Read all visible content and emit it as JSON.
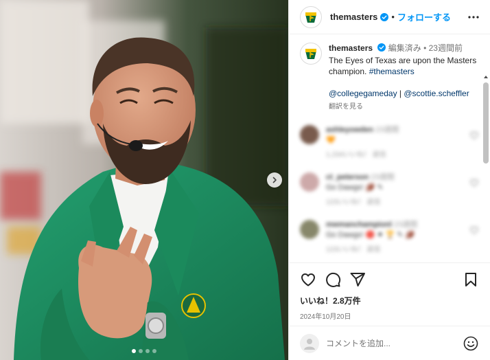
{
  "post": {
    "username": "themasters",
    "follow_label": "フォローする",
    "separator": "•",
    "media": {
      "dot_count": 4,
      "active_dot": 0
    },
    "caption": {
      "username": "themasters",
      "edited": "編集済み",
      "dot": "•",
      "time": "23週間前",
      "text": "The Eyes of Texas are upon the Masters champion. ",
      "hashtag": "#themasters",
      "mention_1": "@collegegameday",
      "mention_sep": " | ",
      "mention_2": "@scottie.scheffler",
      "translate": "翻訳を見る"
    },
    "comments": [
      {
        "user": "ashleyowden",
        "time": "23週間",
        "body": "🧡",
        "meta": "1,234いいね！ 返信",
        "avatar_color": "#6b4a3a"
      },
      {
        "user": "ct_peterson",
        "time": "23週間",
        "body": "Go Dawgs! 🏈 ✎",
        "meta": "123いいね！ 返信",
        "avatar_color": "#c8a0a0"
      },
      {
        "user": "mwmanchampionl",
        "time": "23週間",
        "body": "Go Dawgs! 🔴 ⚫ 🏆 ✎ 🏈",
        "meta": "123いいね！ 返信",
        "avatar_color": "#7a7a5a"
      }
    ],
    "likes": "いいね！2.8万件",
    "date": "2024年10月20日",
    "comment_placeholder": "コメントを追加..."
  },
  "colors": {
    "accent": "#0095f6",
    "verified": "#0095f6",
    "link": "#00376b",
    "jacket": "#1f8a5b",
    "masters_yellow": "#f3c300",
    "masters_green": "#0b6b3a"
  }
}
